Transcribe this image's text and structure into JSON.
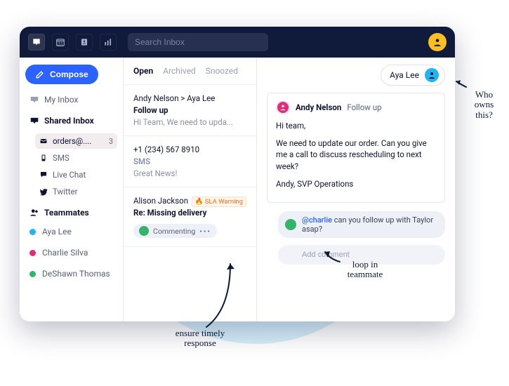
{
  "topbar": {
    "search_placeholder": "Search Inbox"
  },
  "sidebar": {
    "compose_label": "Compose",
    "my_inbox": "My Inbox",
    "shared_inbox": "Shared Inbox",
    "channels": [
      {
        "label": "orders@....",
        "badge": "3"
      },
      {
        "label": "SMS"
      },
      {
        "label": "Live Chat"
      },
      {
        "label": "Twitter"
      }
    ],
    "teammates_title": "Teammates",
    "teammates": [
      {
        "name": "Aya Lee",
        "color": "blue"
      },
      {
        "name": "Charlie Silva",
        "color": "red"
      },
      {
        "name": "DeShawn Thomas",
        "color": "green"
      }
    ]
  },
  "threadlist": {
    "tabs": {
      "open": "Open",
      "archived": "Archived",
      "snoozed": "Snoozed"
    },
    "items": [
      {
        "from": "Andy Nelson > Aya Lee",
        "subject": "Follow up",
        "preview": "Hi Team, We need to upda..."
      },
      {
        "phone": "+1 (234) 567 8910",
        "subject": "SMS",
        "preview": "Great News!"
      },
      {
        "from": "Alison Jackson",
        "sla": "SLA Warning",
        "subject": "Re: Missing delivery",
        "commenting": "Commenting"
      }
    ]
  },
  "conversation": {
    "assignee": "Aya Lee",
    "message": {
      "from": "Andy Nelson",
      "subject": "Follow up",
      "greeting": "Hi team,",
      "body": "We need to update our order. Can you give me a call to discuss rescheduling to next week?",
      "signoff": "Andy, SVP Operations"
    },
    "comment": {
      "mention": "@charlie",
      "text": " can you follow up with Taylor asap?"
    },
    "comment_placeholder": "Add comment"
  },
  "annotations": {
    "who_owns": "Who owns this?",
    "timely": "ensure timely response",
    "loop": "loop in teammate"
  }
}
